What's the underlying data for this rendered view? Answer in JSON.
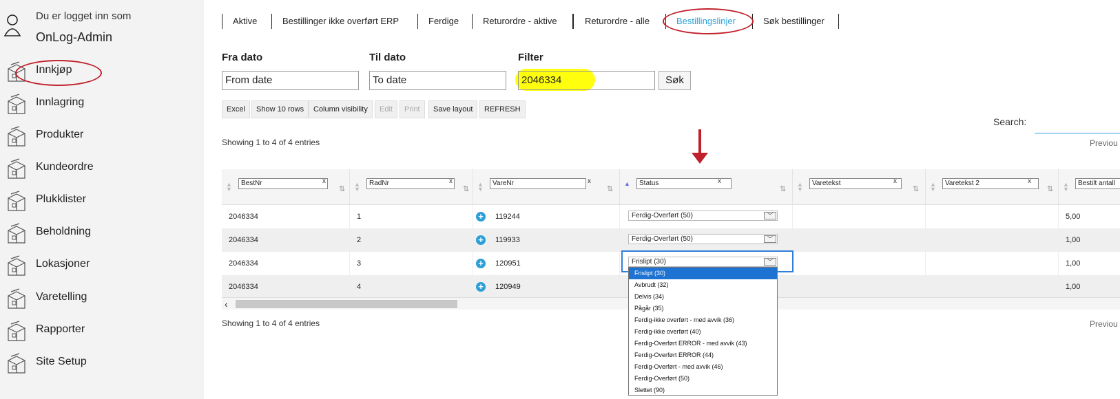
{
  "sidebar": {
    "user_line1": "Du er logget inn som",
    "user_line2": "OnLog-Admin",
    "items": [
      {
        "label": "Innkjøp"
      },
      {
        "label": "Innlagring"
      },
      {
        "label": "Produkter"
      },
      {
        "label": "Kundeordre"
      },
      {
        "label": "Plukklister"
      },
      {
        "label": "Beholdning"
      },
      {
        "label": "Lokasjoner"
      },
      {
        "label": "Varetelling"
      },
      {
        "label": "Rapporter"
      },
      {
        "label": "Site Setup"
      }
    ]
  },
  "tabs": [
    {
      "label": "Aktive"
    },
    {
      "label": "Bestillinger ikke overført ERP"
    },
    {
      "label": "Ferdige"
    },
    {
      "label": "Returordre - aktive"
    },
    {
      "label": "Returordre - alle"
    },
    {
      "label": "Bestillingslinjer"
    },
    {
      "label": "Søk bestillinger"
    }
  ],
  "filters": {
    "from_label": "Fra dato",
    "from_value": "From date",
    "to_label": "Til dato",
    "to_value": "To date",
    "filter_label": "Filter",
    "filter_value": "2046334",
    "search_button": "Søk"
  },
  "toolbar": {
    "excel": "Excel",
    "show_rows": "Show 10 rows",
    "col_vis": "Column visibility",
    "edit": "Edit",
    "print": "Print",
    "save_layout": "Save layout",
    "refresh": "REFRESH"
  },
  "search_label": "Search:",
  "info_text": "Showing 1 to 4 of 4 entries",
  "previous_label": "Previou",
  "table": {
    "columns": [
      {
        "label": "BestNr"
      },
      {
        "label": "RadNr"
      },
      {
        "label": "VareNr"
      },
      {
        "label": "Status"
      },
      {
        "label": "Varetekst"
      },
      {
        "label": "Varetekst 2"
      },
      {
        "label": "Bestilt antall"
      }
    ],
    "clear_symbol": "x",
    "rows": [
      {
        "bestnr": "2046334",
        "radnr": "1",
        "varenr": "119244",
        "status": "Ferdig-Overført (50)",
        "antall": "5,00"
      },
      {
        "bestnr": "2046334",
        "radnr": "2",
        "varenr": "119933",
        "status": "Ferdig-Overført (50)",
        "antall": "1,00"
      },
      {
        "bestnr": "2046334",
        "radnr": "3",
        "varenr": "120951",
        "status": "Frislipt (30)",
        "antall": "1,00"
      },
      {
        "bestnr": "2046334",
        "radnr": "4",
        "varenr": "120949",
        "status": "",
        "antall": "1,00"
      }
    ]
  },
  "status_options": [
    "Frislipt (30)",
    "Avbrudt (32)",
    "Delvis (34)",
    "Pågår (35)",
    "Ferdig-ikke overført - med avvik (36)",
    "Ferdig-ikke overført (40)",
    "Ferdig-Overført ERROR - med avvik (43)",
    "Ferdig-Overført ERROR (44)",
    "Ferdig-Overført - med avvik (46)",
    "Ferdig-Overført (50)",
    "Slettet (90)"
  ],
  "colors": {
    "accent": "#2ba0d8",
    "annotation_red": "#c0202c",
    "highlight_yellow": "#ffff00",
    "selected_option": "#1e73d2"
  }
}
